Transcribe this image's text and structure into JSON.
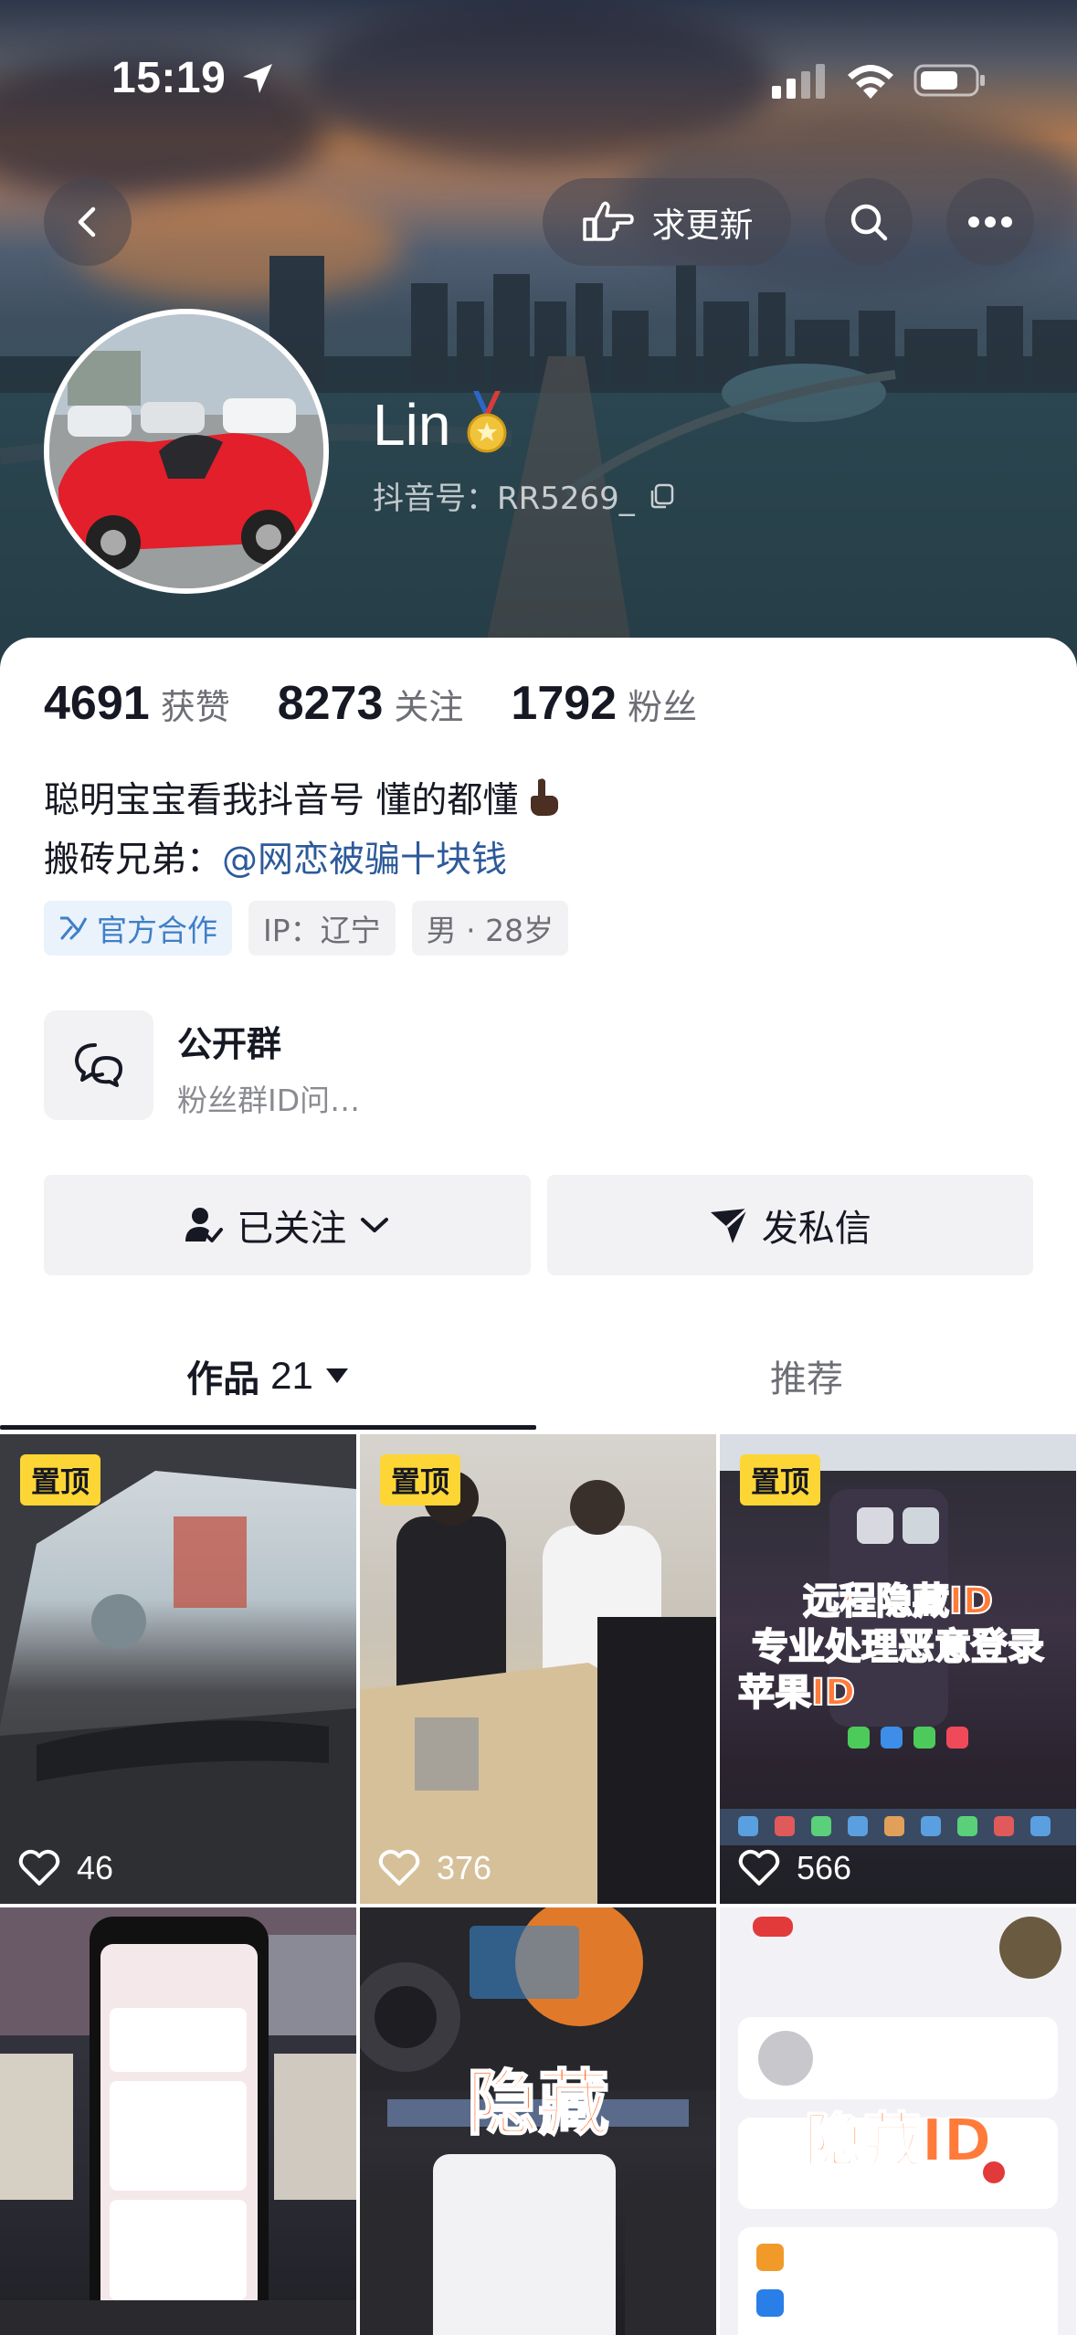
{
  "status_bar": {
    "time": "15:19"
  },
  "top_bar": {
    "request_update_label": "求更新"
  },
  "profile": {
    "name": "Lin",
    "douyin_id": "抖音号：RR5269_"
  },
  "stats": [
    {
      "value": "4691",
      "label": "获赞"
    },
    {
      "value": "8273",
      "label": "关注"
    },
    {
      "value": "1792",
      "label": "粉丝"
    }
  ],
  "bio": {
    "line1": "聪明宝宝看我抖音号 懂的都懂",
    "line2_prefix": "搬砖兄弟：",
    "line2_mention": "@网恋被骗十块钱"
  },
  "tags": {
    "official": "官方合作",
    "ip": "IP：辽宁",
    "gender_age": "男 · 28岁"
  },
  "group": {
    "title": "公开群",
    "subtitle": "粉丝群ID问…"
  },
  "actions": {
    "follow_label": "已关注",
    "message_label": "发私信"
  },
  "tabs": {
    "works_label": "作品",
    "works_count": "21",
    "recommend_label": "推荐"
  },
  "videos": [
    {
      "pinned": "置顶",
      "likes": "46"
    },
    {
      "pinned": "置顶",
      "likes": "376"
    },
    {
      "pinned": "置顶",
      "likes": "566",
      "overlay": [
        "远程隐藏ID",
        "专业处理恶意登录",
        "苹果ID"
      ]
    },
    {
      "likes": ""
    },
    {
      "likes": "",
      "overlay": [
        "隐藏"
      ]
    },
    {
      "likes": "",
      "overlay": [
        "隐藏ID"
      ]
    }
  ],
  "colors": {
    "pin_badge": "#fdd635",
    "mention": "#2d5a9a",
    "official_tag": "#3f7fc7"
  }
}
